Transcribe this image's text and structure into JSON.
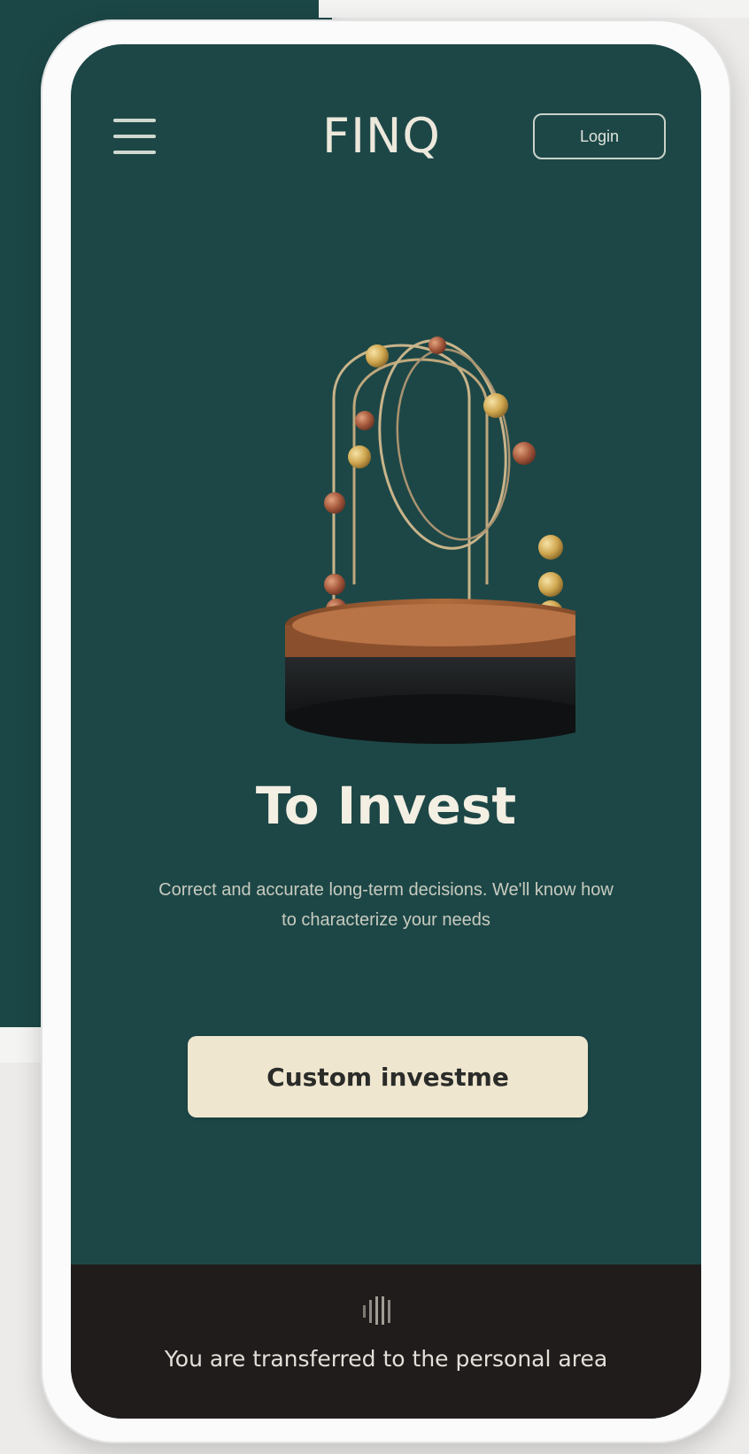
{
  "header": {
    "menu_icon": "hamburger-menu-icon",
    "logo": "FINQ",
    "login_label": "Login"
  },
  "hero": {
    "title": "To Invest",
    "description": "Correct and accurate long-term decisions. We'll know how to characterize your needs",
    "cta_label": "Custom investme"
  },
  "footer": {
    "loader_icon": "loading-bars-icon",
    "status_text": "You are transferred to the personal area"
  },
  "colors": {
    "screen_bg": "#1d4747",
    "cta_bg": "#efe6cf",
    "footer_bg": "#1f1c1b",
    "title_text": "#f3efe2"
  }
}
